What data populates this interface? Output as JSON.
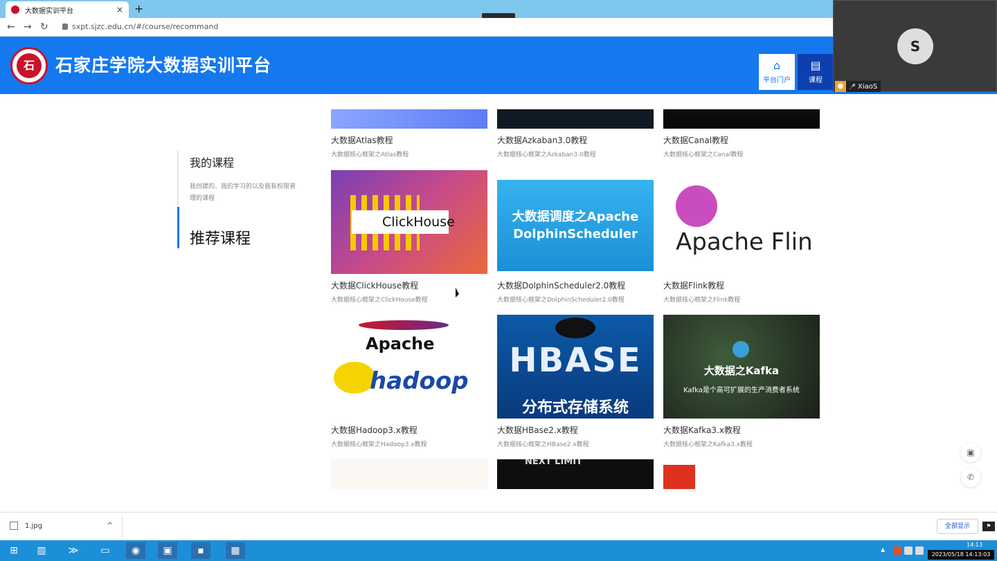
{
  "browser": {
    "tab_title": "大数据实训平台",
    "tab_close": "×",
    "new_tab": "+",
    "collapse_icon": "⌄",
    "url": "sxpt.sjzc.edu.cn/#/course/recommand",
    "back": "←",
    "forward": "→",
    "reload": "↻"
  },
  "header": {
    "title": "石家庄学院大数据实训平台",
    "logo_text": "石",
    "nav": {
      "portal_label": "平台门户",
      "portal_icon": "⌂",
      "course_label": "课程",
      "course_icon": "▤"
    }
  },
  "video_call": {
    "participant_name": "XiaoS",
    "avatar_glyph": "S",
    "mic_icon": "🎤"
  },
  "sidebar": {
    "my_courses": {
      "title": "我的课程",
      "desc": "我创建的、我的学习的以及我有权限管理的课程"
    },
    "recommended": {
      "title": "推荐课程"
    }
  },
  "courses": [
    {
      "title": "大数据Atlas教程",
      "subtitle": "大数据核心框架之Atlas教程"
    },
    {
      "title": "大数据Azkaban3.0教程",
      "subtitle": "大数据核心框架之Azkaban3.0教程"
    },
    {
      "title": "大数据Canal教程",
      "subtitle": "大数据核心框架之Canal教程"
    },
    {
      "title": "大数据ClickHouse教程",
      "subtitle": "大数据核心框架之ClickHouse教程",
      "image_text": "ClickHouse"
    },
    {
      "title": "大数据DolphinScheduler2.0教程",
      "subtitle": "大数据核心框架之DolphinScheduler2.0教程",
      "image_text": "大数据调度之Apache DolphinScheduler"
    },
    {
      "title": "大数据Flink教程",
      "subtitle": "大数据核心框架之Flink教程",
      "image_text": "Apache Flin"
    },
    {
      "title": "大数据Hadoop3.x教程",
      "subtitle": "大数据核心框架之Hadoop3.x教程",
      "image_text_1": "Apache",
      "image_text_2": "hadoop"
    },
    {
      "title": "大数据HBase2.x教程",
      "subtitle": "大数据核心框架之HBase2.x教程",
      "image_text_1": "HBASE",
      "image_text_2": "分布式存储系统"
    },
    {
      "title": "大数据Kafka3.x教程",
      "subtitle": "大数据核心框架之Kafka3.x教程",
      "image_text_1": "大数据之Kafka",
      "image_text_2": "Kafka是个高可扩展的生产消费者系统"
    },
    {
      "image_text": "NEXT LIMIT"
    }
  ],
  "floating": {
    "save_icon": "▣",
    "phone_icon": "✆"
  },
  "downloads": {
    "file_name": "1.jpg",
    "chevron": "^",
    "show_all": "全部显示"
  },
  "taskbar": {
    "time": "14:13",
    "datetime": "2023/05/18 14:13:03"
  },
  "colors": {
    "header_blue": "#1478ef",
    "active_nav": "#0d3fb0",
    "tabbar": "#7ec8ee",
    "taskbar": "#1d8fd8"
  }
}
